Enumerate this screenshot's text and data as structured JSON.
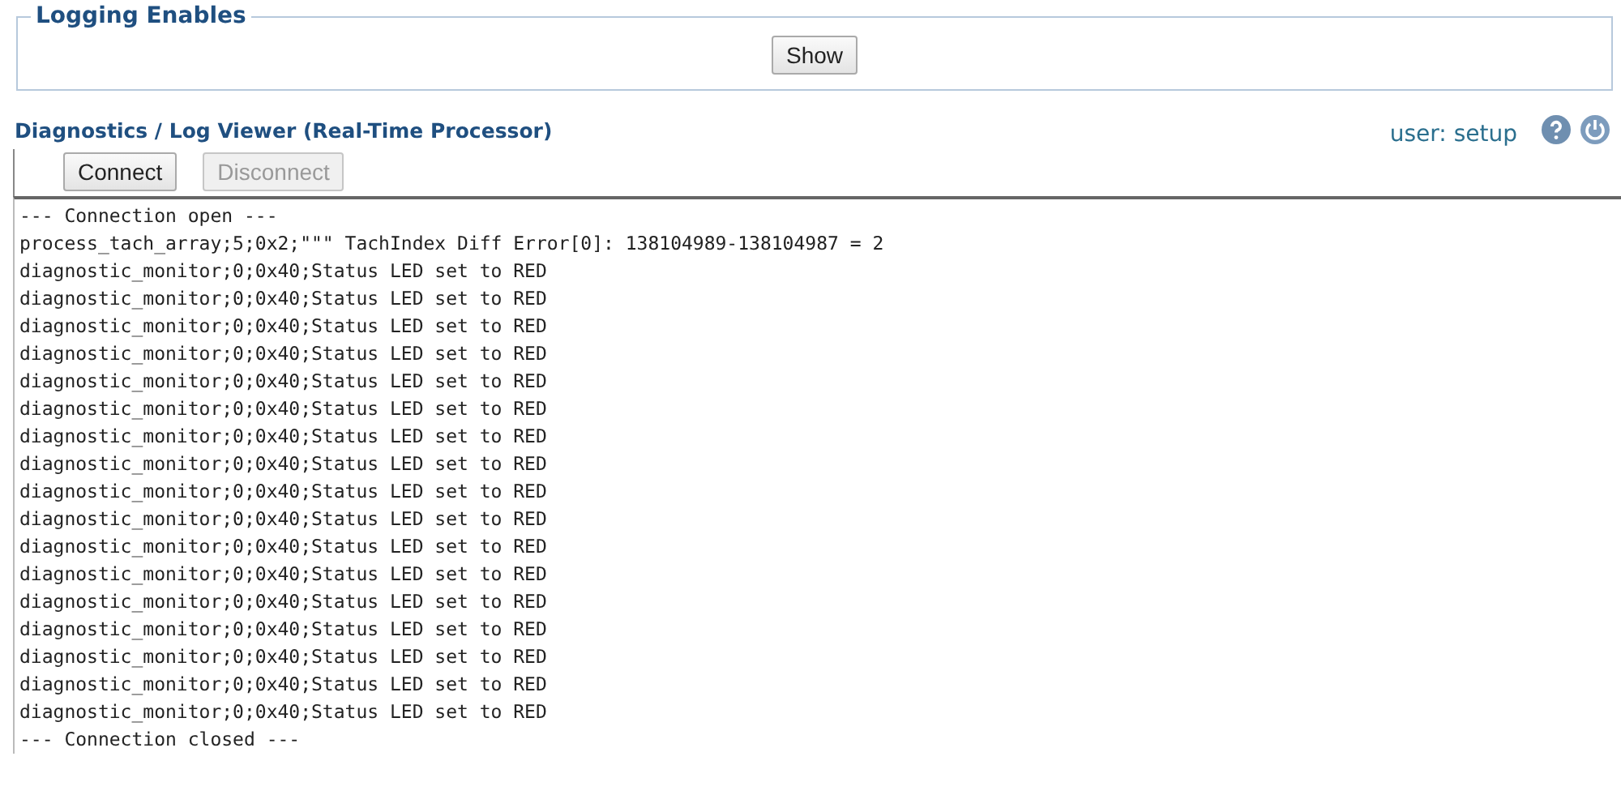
{
  "logging_enables": {
    "legend": "Logging Enables",
    "button": "Show"
  },
  "header": {
    "title": "Diagnostics / Log Viewer (Real-Time Processor)",
    "user": "user: setup"
  },
  "buttons": [
    {
      "label": "Connect",
      "disabled": false
    },
    {
      "label": "Disconnect",
      "disabled": true
    }
  ],
  "log_lines": [
    "--- Connection open ---",
    "process_tach_array;5;0x2;\"\"\" TachIndex Diff Error[0]: 138104989-138104987 = 2",
    "diagnostic_monitor;0;0x40;Status LED set to RED",
    "diagnostic_monitor;0;0x40;Status LED set to RED",
    "diagnostic_monitor;0;0x40;Status LED set to RED",
    "diagnostic_monitor;0;0x40;Status LED set to RED",
    "diagnostic_monitor;0;0x40;Status LED set to RED",
    "diagnostic_monitor;0;0x40;Status LED set to RED",
    "diagnostic_monitor;0;0x40;Status LED set to RED",
    "diagnostic_monitor;0;0x40;Status LED set to RED",
    "diagnostic_monitor;0;0x40;Status LED set to RED",
    "diagnostic_monitor;0;0x40;Status LED set to RED",
    "diagnostic_monitor;0;0x40;Status LED set to RED",
    "diagnostic_monitor;0;0x40;Status LED set to RED",
    "diagnostic_monitor;0;0x40;Status LED set to RED",
    "diagnostic_monitor;0;0x40;Status LED set to RED",
    "diagnostic_monitor;0;0x40;Status LED set to RED",
    "diagnostic_monitor;0;0x40;Status LED set to RED",
    "diagnostic_monitor;0;0x40;Status LED set to RED",
    "--- Connection closed ---"
  ]
}
